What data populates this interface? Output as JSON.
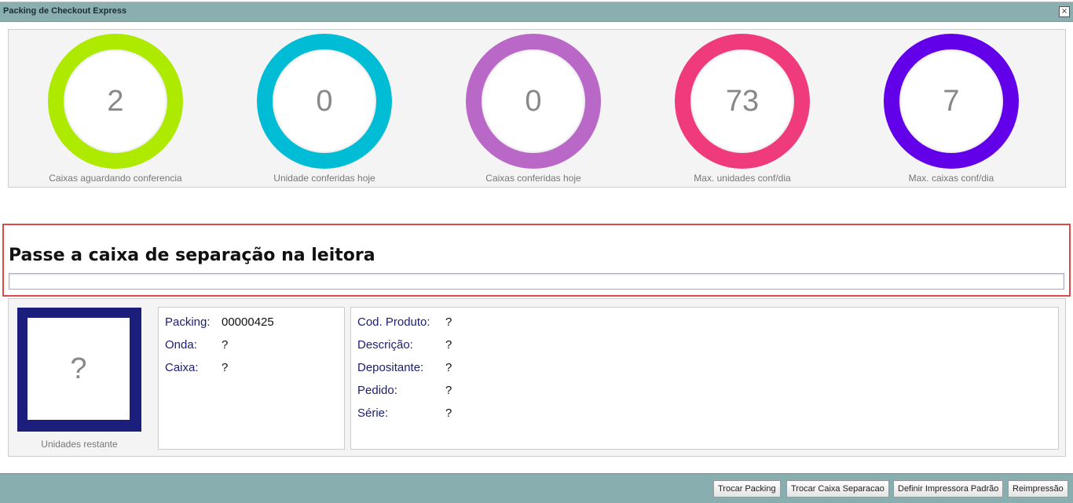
{
  "window": {
    "title": "Packing de Checkout Express",
    "close_icon": "×"
  },
  "stats": [
    {
      "value": "2",
      "label": "Caixas aguardando conferencia",
      "color": "#aeea00"
    },
    {
      "value": "0",
      "label": "Unidade conferidas hoje",
      "color": "#00bcd4"
    },
    {
      "value": "0",
      "label": "Caixas conferidas hoje",
      "color": "#ba68c8"
    },
    {
      "value": "73",
      "label": "Max. unidades conf/dia",
      "color": "#ef3b7b"
    },
    {
      "value": "7",
      "label": "Max. caixas conf/dia",
      "color": "#6200ea"
    }
  ],
  "scan": {
    "title": "Passe a caixa de separação na leitora",
    "value": ""
  },
  "units": {
    "value": "?",
    "label": "Unidades restante"
  },
  "packing_info": [
    {
      "label": "Packing:",
      "value": "00000425"
    },
    {
      "label": "Onda:",
      "value": "?"
    },
    {
      "label": "Caixa:",
      "value": "?"
    }
  ],
  "product_info": [
    {
      "label": "Cod. Produto:",
      "value": "?"
    },
    {
      "label": "Descrição:",
      "value": "?"
    },
    {
      "label": "Depositante:",
      "value": "?"
    },
    {
      "label": "Pedido:",
      "value": "?"
    },
    {
      "label": "Série:",
      "value": "?"
    }
  ],
  "buttons": {
    "trocar_packing": "Trocar Packing",
    "trocar_caixa": "Trocar Caixa Separacao",
    "definir_impressora": "Definir Impressora Padrão",
    "reimpressao": "Reimpressão"
  }
}
